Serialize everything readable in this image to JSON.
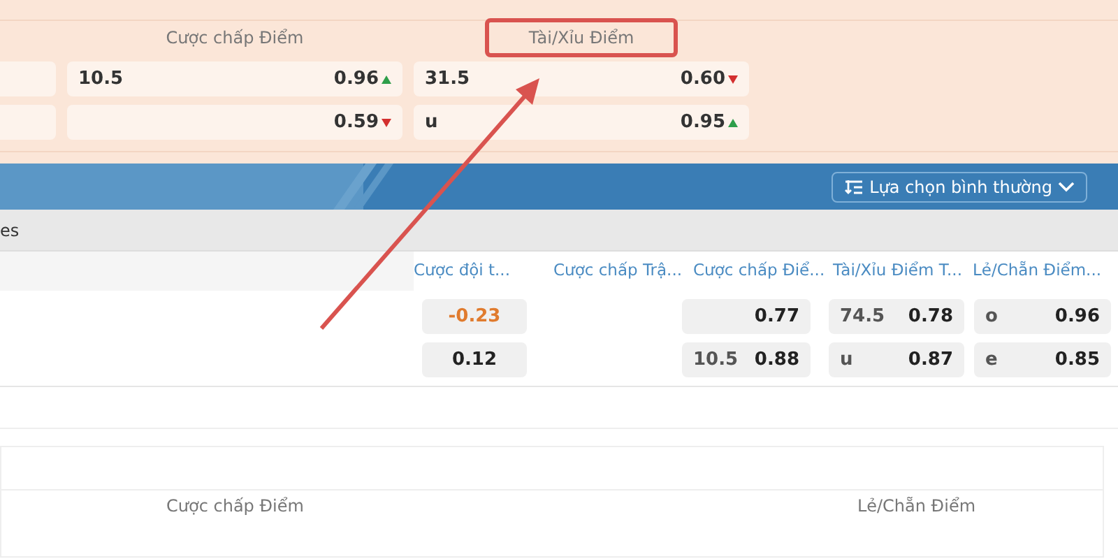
{
  "top_market": {
    "headers": [
      {
        "label": "Cược chấp Điểm",
        "highlighted": false
      },
      {
        "label": "Tài/Xỉu Điểm",
        "highlighted": true
      }
    ],
    "rows": [
      [
        {
          "line": "10.5",
          "odds": "0.96",
          "rising": true
        },
        {
          "line": "31.5",
          "odds": "0.60",
          "rising": false
        }
      ],
      [
        {
          "odds": "0.59",
          "rising": false
        },
        {
          "line": "u",
          "odds": "0.95",
          "rising": true
        }
      ]
    ]
  },
  "toolbar": {
    "sort_button": "Lựa chọn bình thường"
  },
  "league_row": {
    "title": "es"
  },
  "table": {
    "columns": [
      "Cược đội t...",
      "Cược chấp Trậ...",
      "Cược chấp Điể...",
      "Tài/Xỉu Điểm T...",
      "Lẻ/Chẵn Điểm..."
    ],
    "rows": [
      {
        "team_odds": {
          "value": "-0.23",
          "negative": true
        },
        "handicap": {
          "odds": "0.77"
        },
        "total": {
          "line": "74.5",
          "odds": "0.78"
        },
        "odd_even": {
          "line": "o",
          "odds": "0.96"
        }
      },
      {
        "team_odds": {
          "value": "0.12",
          "negative": false
        },
        "handicap": {
          "line": "10.5",
          "odds": "0.88"
        },
        "total": {
          "line": "u",
          "odds": "0.87"
        },
        "odd_even": {
          "line": "e",
          "odds": "0.85"
        }
      }
    ]
  },
  "bottom_panel": {
    "headers": [
      "Cược chấp Điểm",
      "Lẻ/Chẵn Điểm"
    ]
  }
}
